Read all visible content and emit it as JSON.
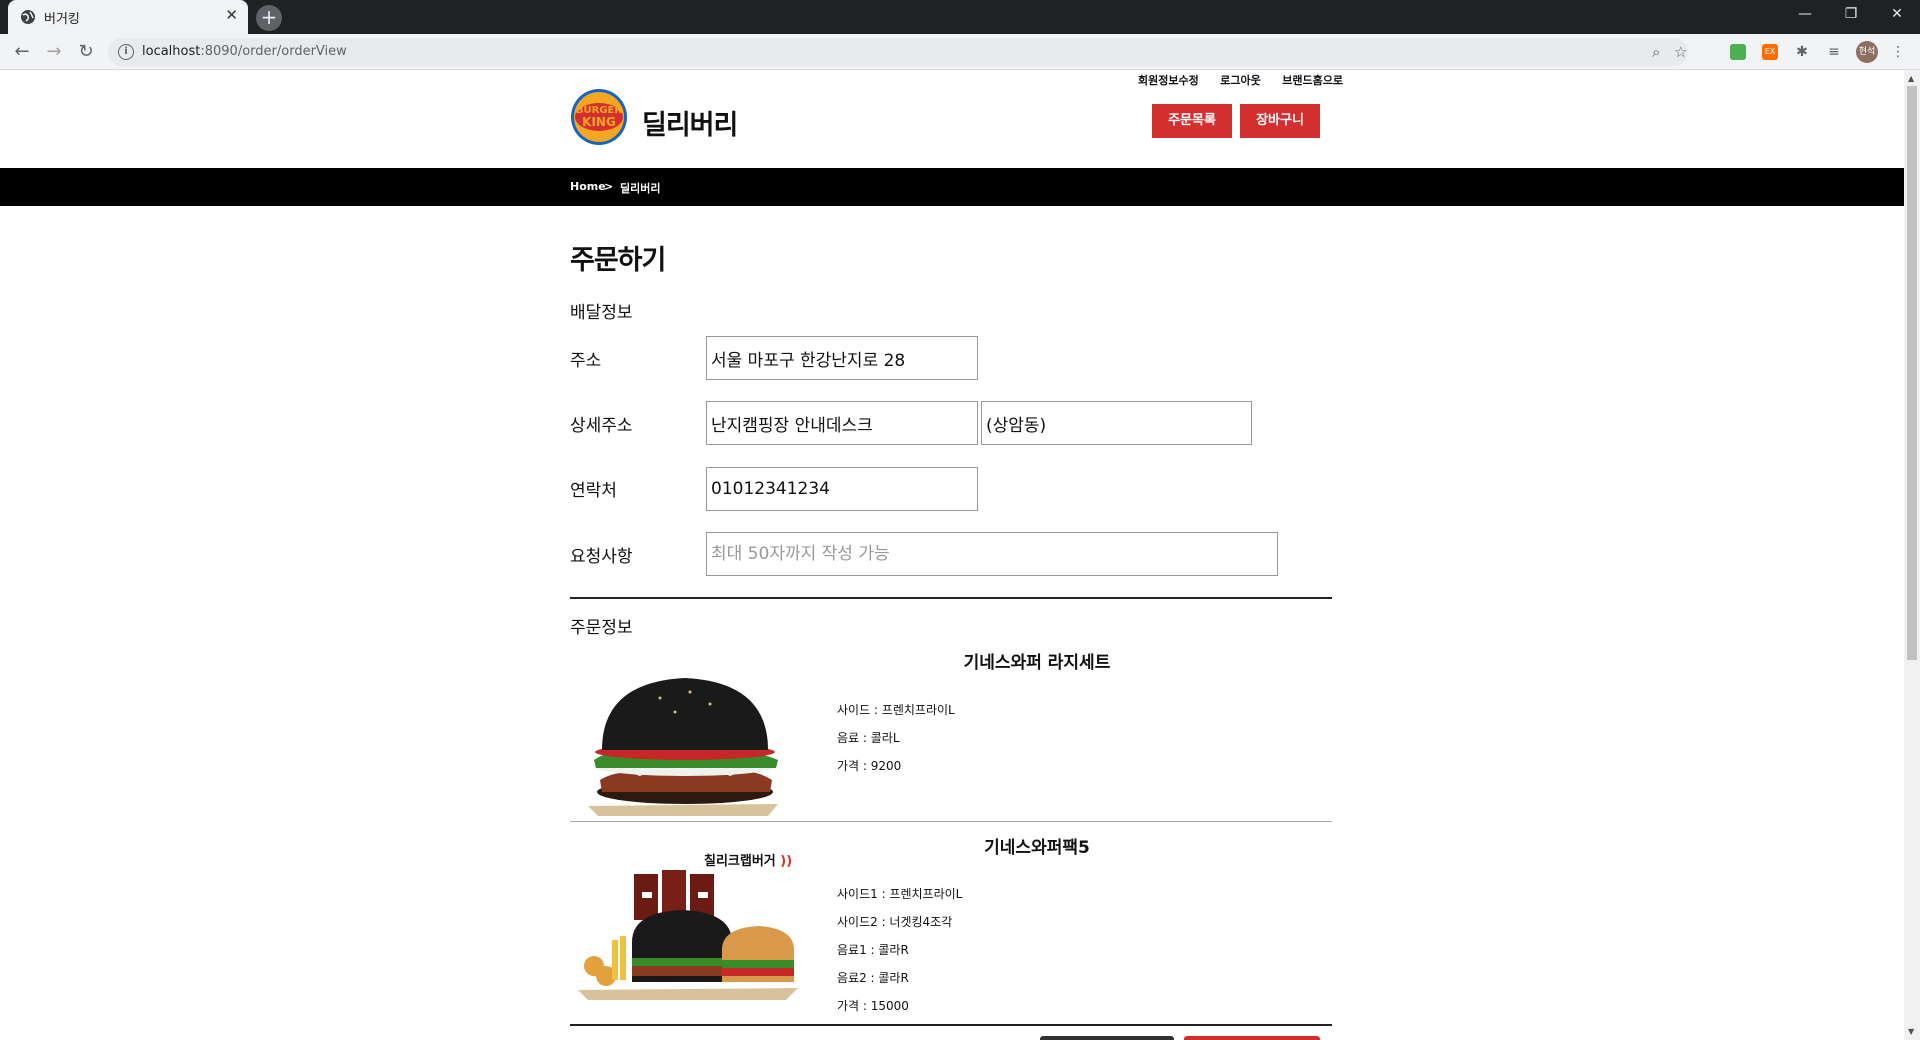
{
  "browser": {
    "tab_title": "버거킹",
    "url_host": "localhost",
    "url_rest": ":8090/order/orderView",
    "profile_label": "현석"
  },
  "header": {
    "top_links": [
      "회원정보수정",
      "로그아웃",
      "브랜드홈으로"
    ],
    "logo_text_line1": "BURGER",
    "logo_text_line2": "KING",
    "title": "딜리버리",
    "buttons": [
      "주문목록",
      "장바구니"
    ]
  },
  "breadcrumb": {
    "home": "Home",
    "separator": ">",
    "current": "딜리버리"
  },
  "order": {
    "title": "주문하기",
    "delivery_section": "배달정보",
    "fields": {
      "address_label": "주소",
      "address_value": "서울 마포구 한강난지로 28",
      "detail_label": "상세주소",
      "detail_value": "난지캠핑장 안내데스크",
      "detail_extra": "(상암동)",
      "phone_label": "연락처",
      "phone_value": "01012341234",
      "request_label": "요청사항",
      "request_placeholder": "최대 50자까지 작성 가능"
    },
    "order_section": "주문정보",
    "products": [
      {
        "name": "기네스와퍼 라지세트",
        "lines": [
          "사이드 : 프렌치프라이L",
          "음료 : 콜라L",
          "가격 : 9200"
        ]
      },
      {
        "name": "기네스와퍼팩5",
        "image_caption": "칠리크랩버거",
        "lines": [
          "사이드1 : 프렌치프라이L",
          "사이드2 : 너겟킹4조각",
          "음료1 : 콜라R",
          "음료2 : 콜라R",
          "가격 : 15000"
        ]
      }
    ]
  },
  "colors": {
    "accent_red": "#d32f2f",
    "breadcrumb_bg": "#000000"
  }
}
